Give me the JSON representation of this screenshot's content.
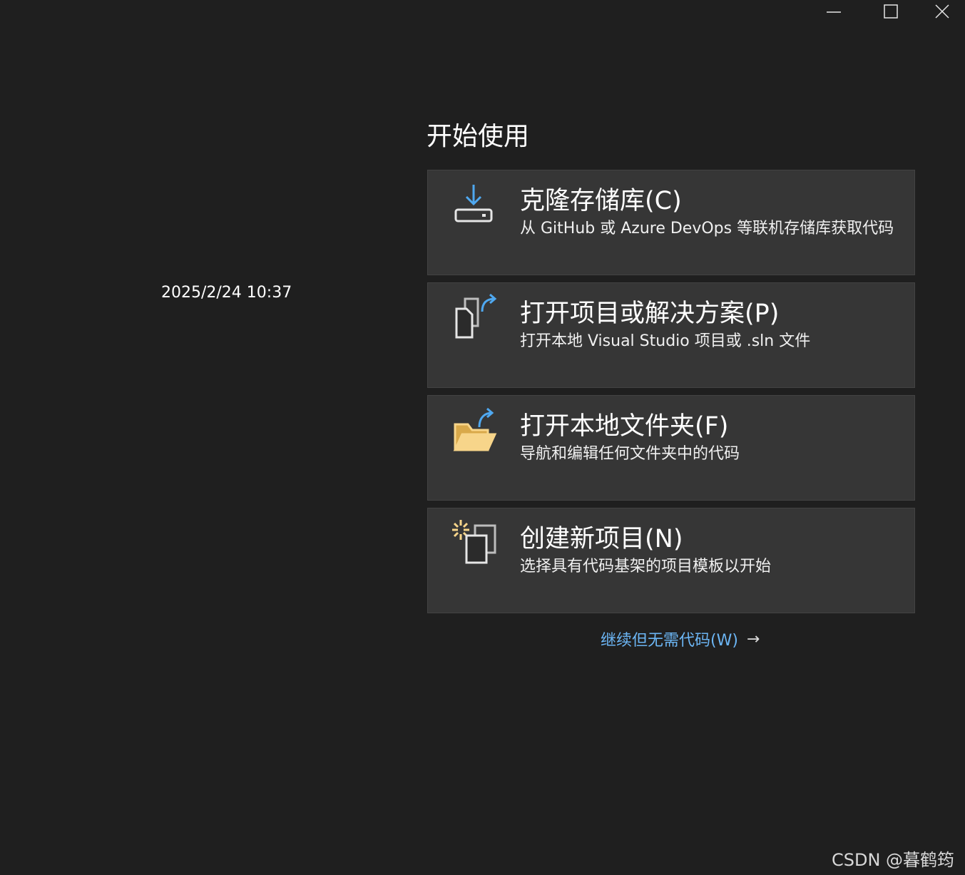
{
  "window": {
    "controls": {
      "minimize_icon": "minimize-icon",
      "maximize_icon": "maximize-icon",
      "close_icon": "close-icon"
    }
  },
  "timestamp": "2025/2/24 10:37",
  "start": {
    "heading": "开始使用",
    "cards": [
      {
        "title": "克隆存储库(C)",
        "description": "从 GitHub 或 Azure DevOps 等联机存储库获取代码",
        "icon": "clone-download-icon"
      },
      {
        "title": "打开项目或解决方案(P)",
        "description": "打开本地 Visual Studio 项目或 .sln 文件",
        "icon": "open-project-icon"
      },
      {
        "title": "打开本地文件夹(F)",
        "description": "导航和编辑任何文件夹中的代码",
        "icon": "open-folder-icon"
      },
      {
        "title": "创建新项目(N)",
        "description": "选择具有代码基架的项目模板以开始",
        "icon": "new-project-icon"
      }
    ],
    "continue_link": "继续但无需代码(W)",
    "continue_arrow": "→"
  },
  "watermark": "CSDN @暮鹤筠",
  "colors": {
    "background": "#1f1f1f",
    "card": "#363636",
    "link": "#6cb6f5",
    "accent_blue": "#4fa8f0",
    "folder_yellow": "#f7d58a"
  }
}
